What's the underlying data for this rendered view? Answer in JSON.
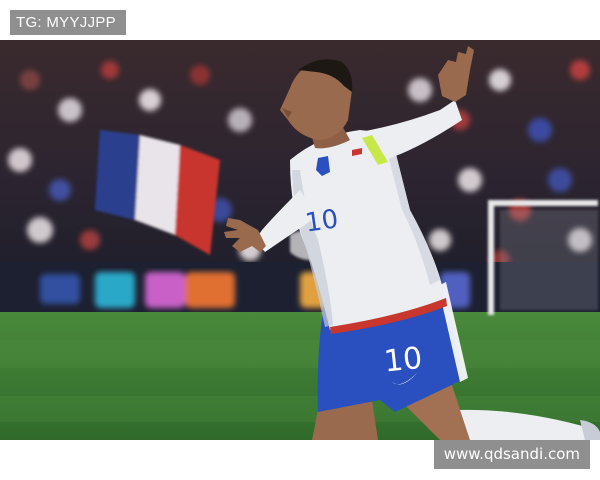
{
  "watermark_top": "TG: MYYJJPP",
  "watermark_bottom": "www.qdsandi.com",
  "jersey_number": "10",
  "shorts_number": "10",
  "colors": {
    "jersey": "#ecedf1",
    "shorts": "#2a4fbf",
    "pitch": "#3e7d34",
    "captain_band": "#c8e84a",
    "watermark_bg": "#8f8f8f"
  }
}
